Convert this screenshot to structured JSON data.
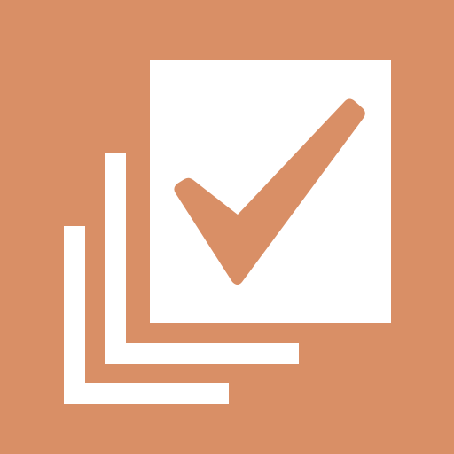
{
  "icon": {
    "name": "stacked-checklist-icon",
    "colors": {
      "background": "#d98f66",
      "foreground": "#ffffff",
      "checkmark": "#d98f66"
    }
  }
}
